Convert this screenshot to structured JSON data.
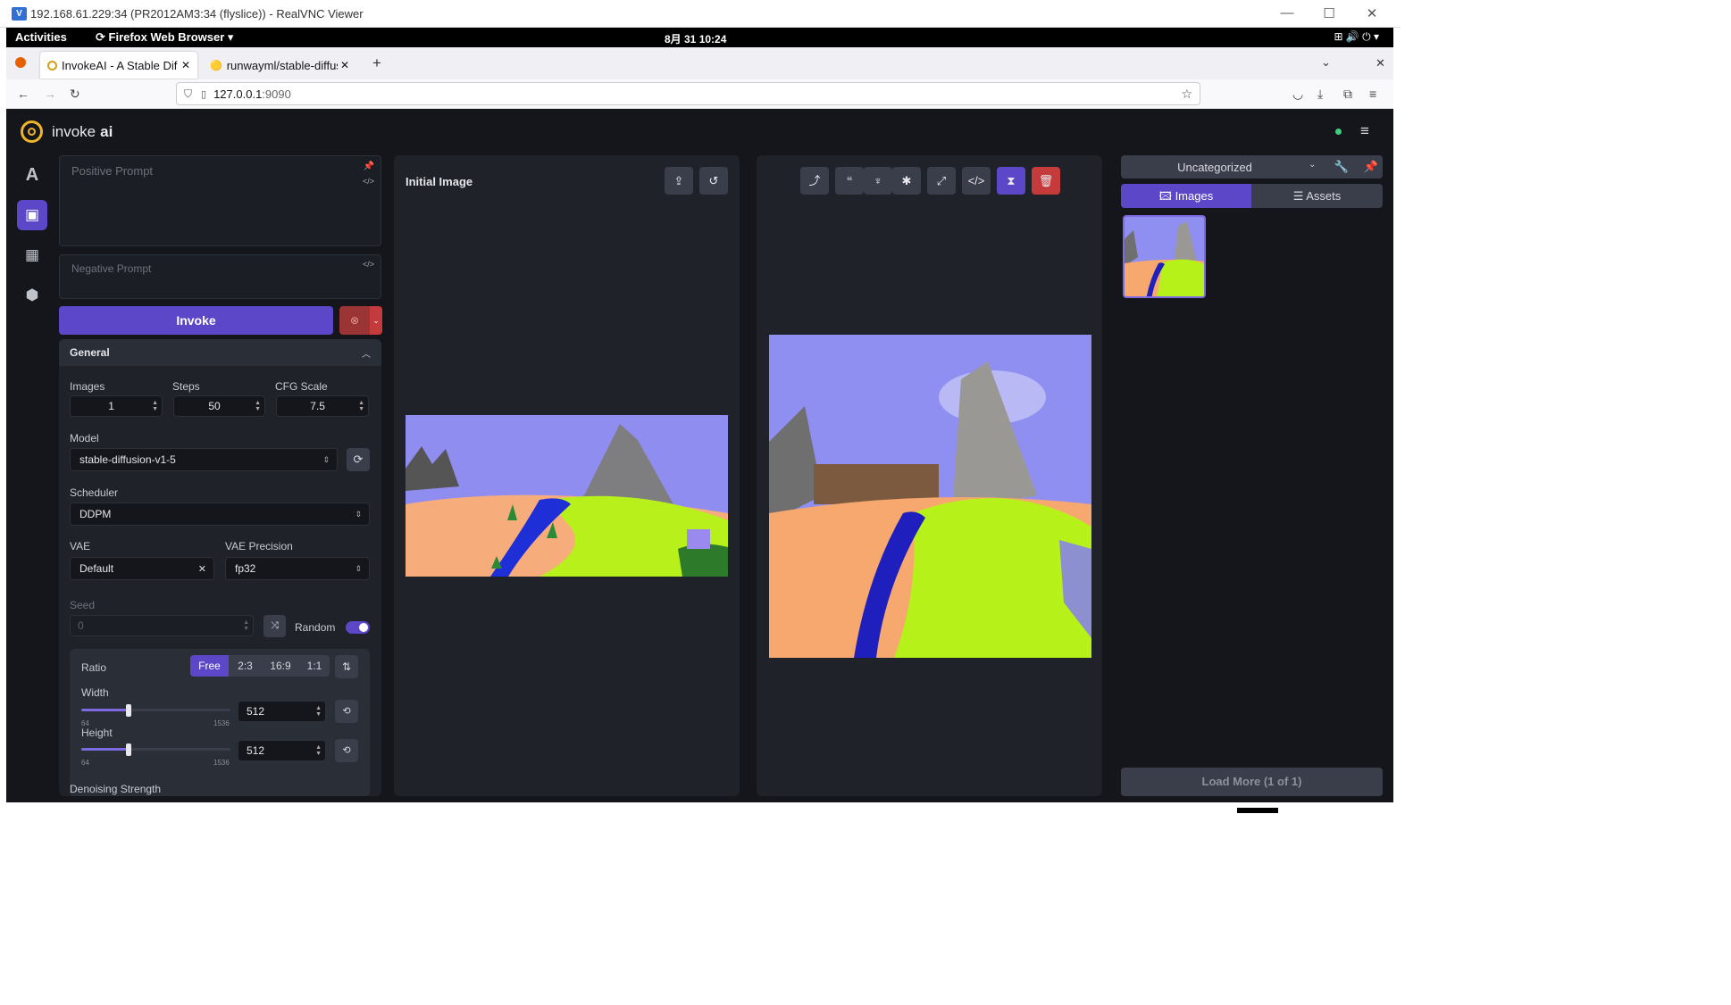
{
  "vnc": {
    "title": "192.168.61.229:34 (PR2012AM3:34 (flyslice)) - RealVNC Viewer",
    "minimize": "—",
    "maximize": "☐",
    "close": "✕"
  },
  "gnome": {
    "activities": "Activities",
    "app_menu": "Firefox Web Browser ▾",
    "clock": "8月 31 10:24",
    "tray": "⊞ 🔊 ⏻ ▾"
  },
  "browser": {
    "tabs": [
      {
        "label": "InvokeAI - A Stable Dif",
        "active": true
      },
      {
        "label": "runwayml/stable-diffus",
        "active": false
      }
    ],
    "url_host": "127.0.0.1",
    "url_port": ":9090"
  },
  "app": {
    "logo_text": "invoke",
    "logo_bold": "ai",
    "prompt": {
      "positive_placeholder": "Positive Prompt",
      "negative_placeholder": "Negative Prompt"
    },
    "invoke_label": "Invoke",
    "general": {
      "title": "General",
      "images_label": "Images",
      "images_value": "1",
      "steps_label": "Steps",
      "steps_value": "50",
      "cfg_label": "CFG Scale",
      "cfg_value": "7.5",
      "model_label": "Model",
      "model_value": "stable-diffusion-v1-5",
      "scheduler_label": "Scheduler",
      "scheduler_value": "DDPM",
      "vae_label": "VAE",
      "vae_value": "Default",
      "vae_precision_label": "VAE Precision",
      "vae_precision_value": "fp32",
      "seed_label": "Seed",
      "seed_value": "0",
      "random_label": "Random",
      "random_on": true,
      "ratio_label": "Ratio",
      "ratio_options": [
        "Free",
        "2:3",
        "16:9",
        "1:1"
      ],
      "ratio_selected": "Free",
      "width_label": "Width",
      "width_value": "512",
      "height_label": "Height",
      "height_value": "512",
      "slider_min": "64",
      "slider_max": "1536",
      "width_fraction": 0.309,
      "height_fraction": 0.309,
      "denoise_label": "Denoising Strength"
    },
    "initial_image_title": "Initial Image",
    "gallery": {
      "board": "Uncategorized",
      "tab_images": "Images",
      "tab_assets": "Assets",
      "load_more": "Load More (1 of 1)"
    },
    "colors": {
      "accent": "#5b47c8",
      "danger": "#c53b3b",
      "status_dot": "#3ecf7a",
      "bg": "#14161c",
      "panel": "#1f2229"
    }
  }
}
